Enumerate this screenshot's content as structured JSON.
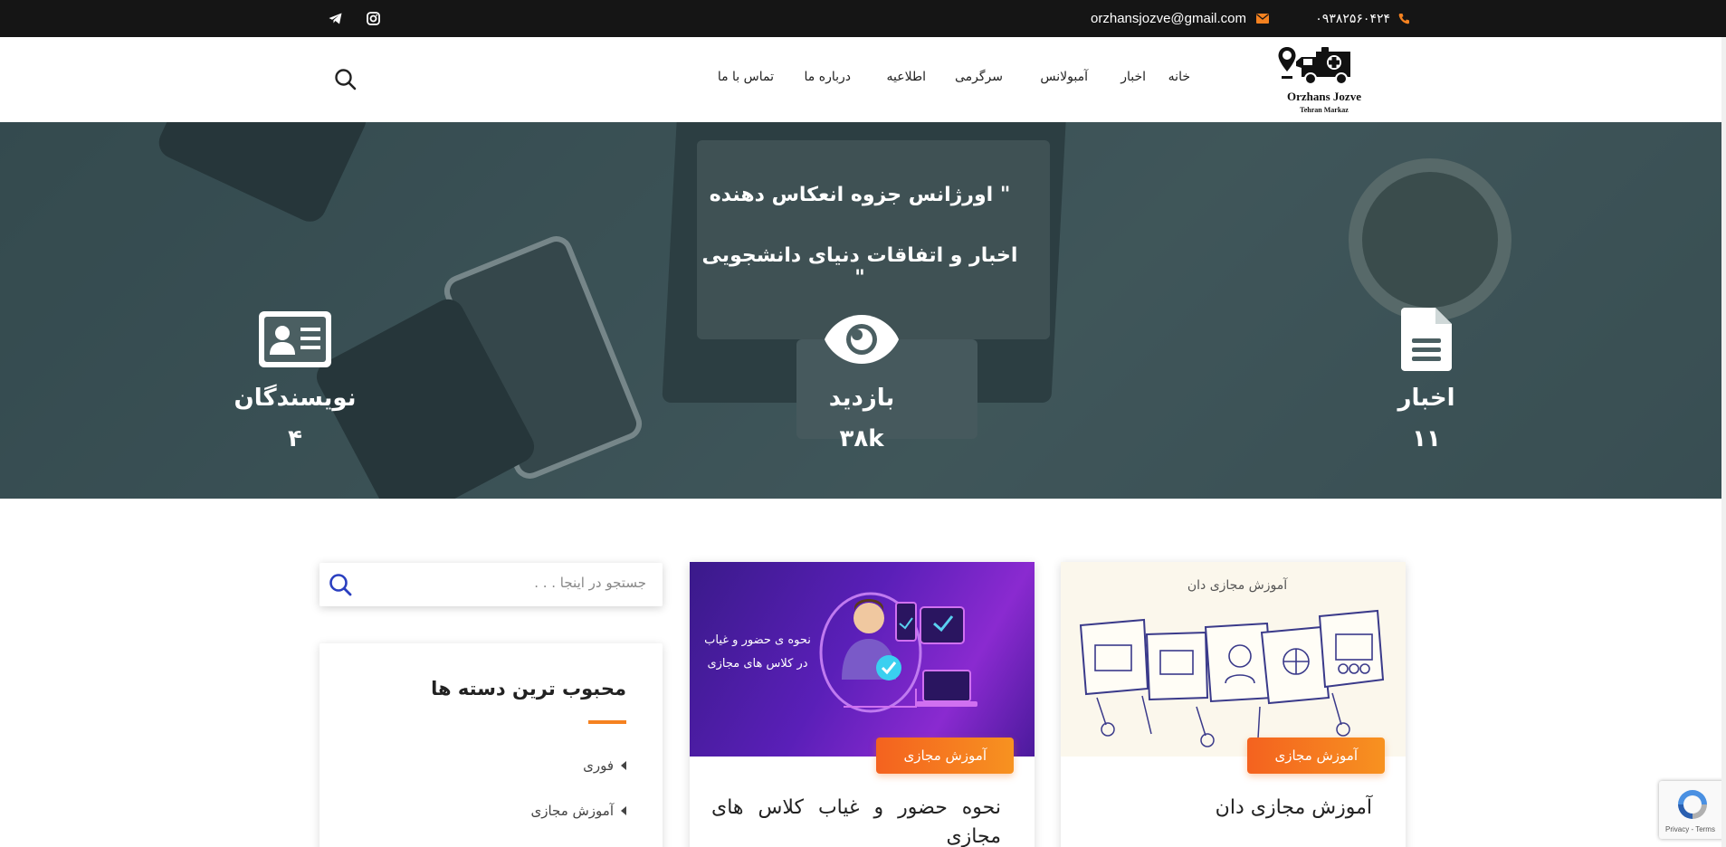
{
  "topbar": {
    "phone": "۰۹۳۸۲۵۶۰۴۲۴",
    "email": "orzhansjozve@gmail.com",
    "social": [
      "instagram-icon",
      "telegram-icon"
    ]
  },
  "logo": {
    "name": "Orzhans Jozve",
    "sub": "Tehran Markaz"
  },
  "nav": {
    "items": [
      "خانه",
      "اخبار",
      "آمبولانس",
      "سرگرمی",
      "اطلاعیه",
      "درباره ما",
      "تماس با ما"
    ]
  },
  "hero": {
    "line1": "\" اورژانس جزوه انعکاس دهنده",
    "line2": "اخبار و اتفاقات دنیای دانشجویی \"",
    "stats": [
      {
        "label": "اخبار",
        "value": "۱۱",
        "icon": "file-icon"
      },
      {
        "label": "بازدید",
        "value": "۳۸k",
        "icon": "eye-icon"
      },
      {
        "label": "نویسندگان",
        "value": "۴",
        "icon": "id-card-icon"
      }
    ]
  },
  "sidebar": {
    "search_placeholder": "جستجو در اینجا . . .",
    "categories_title": "محبوب ترین دسته ها",
    "categories": [
      "فوری",
      "آموزش مجازی"
    ]
  },
  "cards": [
    {
      "image_caption": "آموزش مجازی دان",
      "badge": "آموزش مجازی",
      "title": "آموزش مجازی دان"
    },
    {
      "image_caption_1": "نحوه ی حضور و غیاب",
      "image_caption_2": "در کلاس های مجازی",
      "badge": "آموزش مجازی",
      "title": "نحوه حضور و غیاب کلاس های مجازی"
    }
  ],
  "recaptcha": {
    "text": "Privacy - Terms"
  },
  "colors": {
    "accent": "#f58220",
    "topbar": "#151515"
  }
}
